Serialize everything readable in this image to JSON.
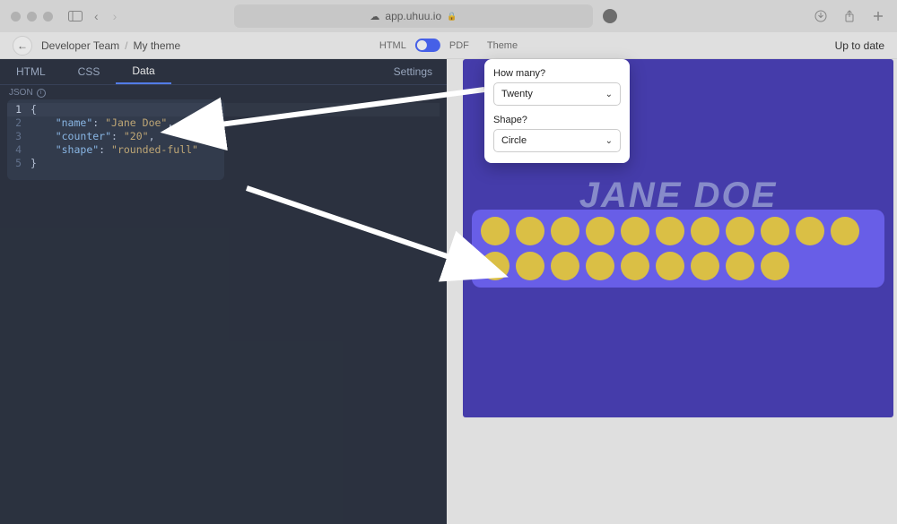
{
  "browser": {
    "url": "app.uhuu.io",
    "lock": "🔒"
  },
  "header": {
    "breadcrumb_team": "Developer Team",
    "breadcrumb_theme": "My theme",
    "html_label": "HTML",
    "pdf_label": "PDF",
    "theme_label": "Theme",
    "status": "Up to date"
  },
  "tabs": {
    "html": "HTML",
    "css": "CSS",
    "data": "Data",
    "settings": "Settings"
  },
  "editor": {
    "json_label": "JSON",
    "lines": [
      {
        "n": "1",
        "raw": "{"
      },
      {
        "n": "2",
        "indent": "    ",
        "key": "\"name\"",
        "sep": ": ",
        "val": "\"Jane Doe\"",
        "tail": ","
      },
      {
        "n": "3",
        "indent": "    ",
        "key": "\"counter\"",
        "sep": ": ",
        "val": "\"20\"",
        "tail": ","
      },
      {
        "n": "4",
        "indent": "    ",
        "key": "\"shape\"",
        "sep": ": ",
        "val": "\"rounded-full\"",
        "tail": ""
      },
      {
        "n": "5",
        "raw": "}"
      }
    ]
  },
  "form": {
    "q1_label": "How many?",
    "q1_value": "Twenty",
    "q2_label": "Shape?",
    "q2_value": "Circle"
  },
  "preview": {
    "hero": "JANE DOE",
    "dot_count": 20
  }
}
